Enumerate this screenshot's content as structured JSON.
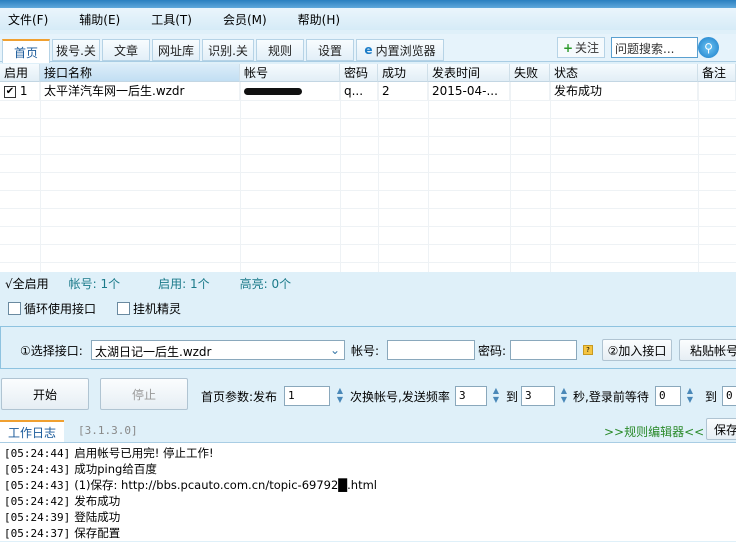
{
  "menu": [
    "文件(F)",
    "辅助(E)",
    "工具(T)",
    "会员(M)",
    "帮助(H)"
  ],
  "tabs": [
    "首页",
    "拨号.关",
    "文章",
    "网址库",
    "识别.关",
    "规则",
    "设置",
    "内置浏览器"
  ],
  "follow_label": "关注",
  "search_placeholder": "问题搜索...",
  "table": {
    "headers": [
      "启用",
      "接口名称",
      "帐号",
      "密码",
      "成功",
      "发表时间",
      "失败",
      "状态",
      "备注"
    ],
    "rows": [
      {
        "enabled": true,
        "index": "1",
        "name": "太平洋汽车网一后生.wzdr",
        "account": "",
        "password": "q...",
        "success": "2",
        "time": "2015-04-...",
        "fail": "",
        "status": "发布成功",
        "note": ""
      }
    ]
  },
  "status": {
    "all_enable": "√全启用",
    "accounts": "帐号: 1个",
    "enabled": "启用: 1个",
    "highlight": "高亮: 0个"
  },
  "options": {
    "loop_label": "循环使用接口",
    "loop_checked": false,
    "hook_label": "挂机精灵",
    "hook_checked": false
  },
  "select_panel": {
    "select_label": "①选择接口:",
    "selected": "太湖日记一后生.wzdr",
    "account_label": "帐号:",
    "account_value": "",
    "password_label": "密码:",
    "password_value": "",
    "add_button": "②加入接口",
    "paste_button": "粘贴帐号"
  },
  "controls": {
    "start": "开始",
    "stop": "停止",
    "params_label": "首页参数:发布",
    "publish_count": "1",
    "switch_label": "次换帐号,发送频率",
    "freq_from": "3",
    "to_label": "到",
    "freq_to": "3",
    "wait_label": "秒,登录前等待",
    "wait_from": "0",
    "to_label2": "到",
    "wait_to": "0"
  },
  "log_tabs": {
    "work_log": "工作日志",
    "version": "[3.1.3.0]",
    "rule_editor": ">>规则编辑器<<",
    "save": "保存"
  },
  "log": [
    {
      "ts": "[05:24:44]",
      "msg": "启用帐号已用完! 停止工作!"
    },
    {
      "ts": "[05:24:43]",
      "msg": "成功ping给百度"
    },
    {
      "ts": "[05:24:43]",
      "msg": "(1)保存: http://bbs.pcauto.com.cn/topic-69792█.html"
    },
    {
      "ts": "[05:24:42]",
      "msg": "发布成功"
    },
    {
      "ts": "[05:24:39]",
      "msg": "登陆成功"
    },
    {
      "ts": "[05:24:37]",
      "msg": "保存配置"
    }
  ]
}
